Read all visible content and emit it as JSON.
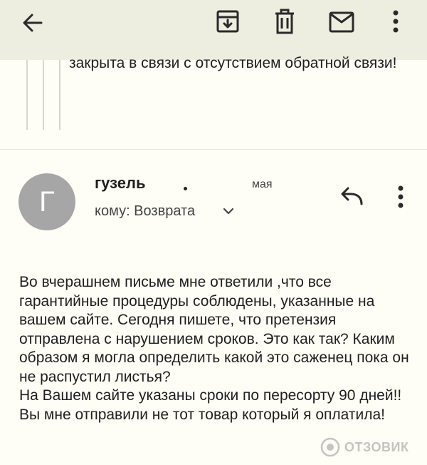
{
  "toolbar": {
    "icons": [
      "back-arrow-icon",
      "archive-icon",
      "delete-icon",
      "mark-unread-icon",
      "more-vert-icon"
    ],
    "background": "#edeee0"
  },
  "quoted": {
    "text": "закрыта в связи с отсутствием обратной связи!"
  },
  "message": {
    "avatar_letter": "Г",
    "avatar_color": "#a6a6a6",
    "sender": "гузель",
    "date": "мая",
    "recipient": "кому: Возврата",
    "body": [
      "Во вчерашнем письме мне ответили ,что все гарантийные процедуры соблюдены, указанные на вашем сайте. Сегодня пишете, что претензия отправлена с нарушением сроков. Это как так? Каким образом я могла определить какой это саженец пока он не распустил листья?",
      "На Вашем сайте указаны сроки по пересорту 90 дней!!",
      "Вы мне отправили не тот товар который я оплатила!"
    ]
  },
  "watermark": {
    "text": "ОТЗОВИК"
  }
}
